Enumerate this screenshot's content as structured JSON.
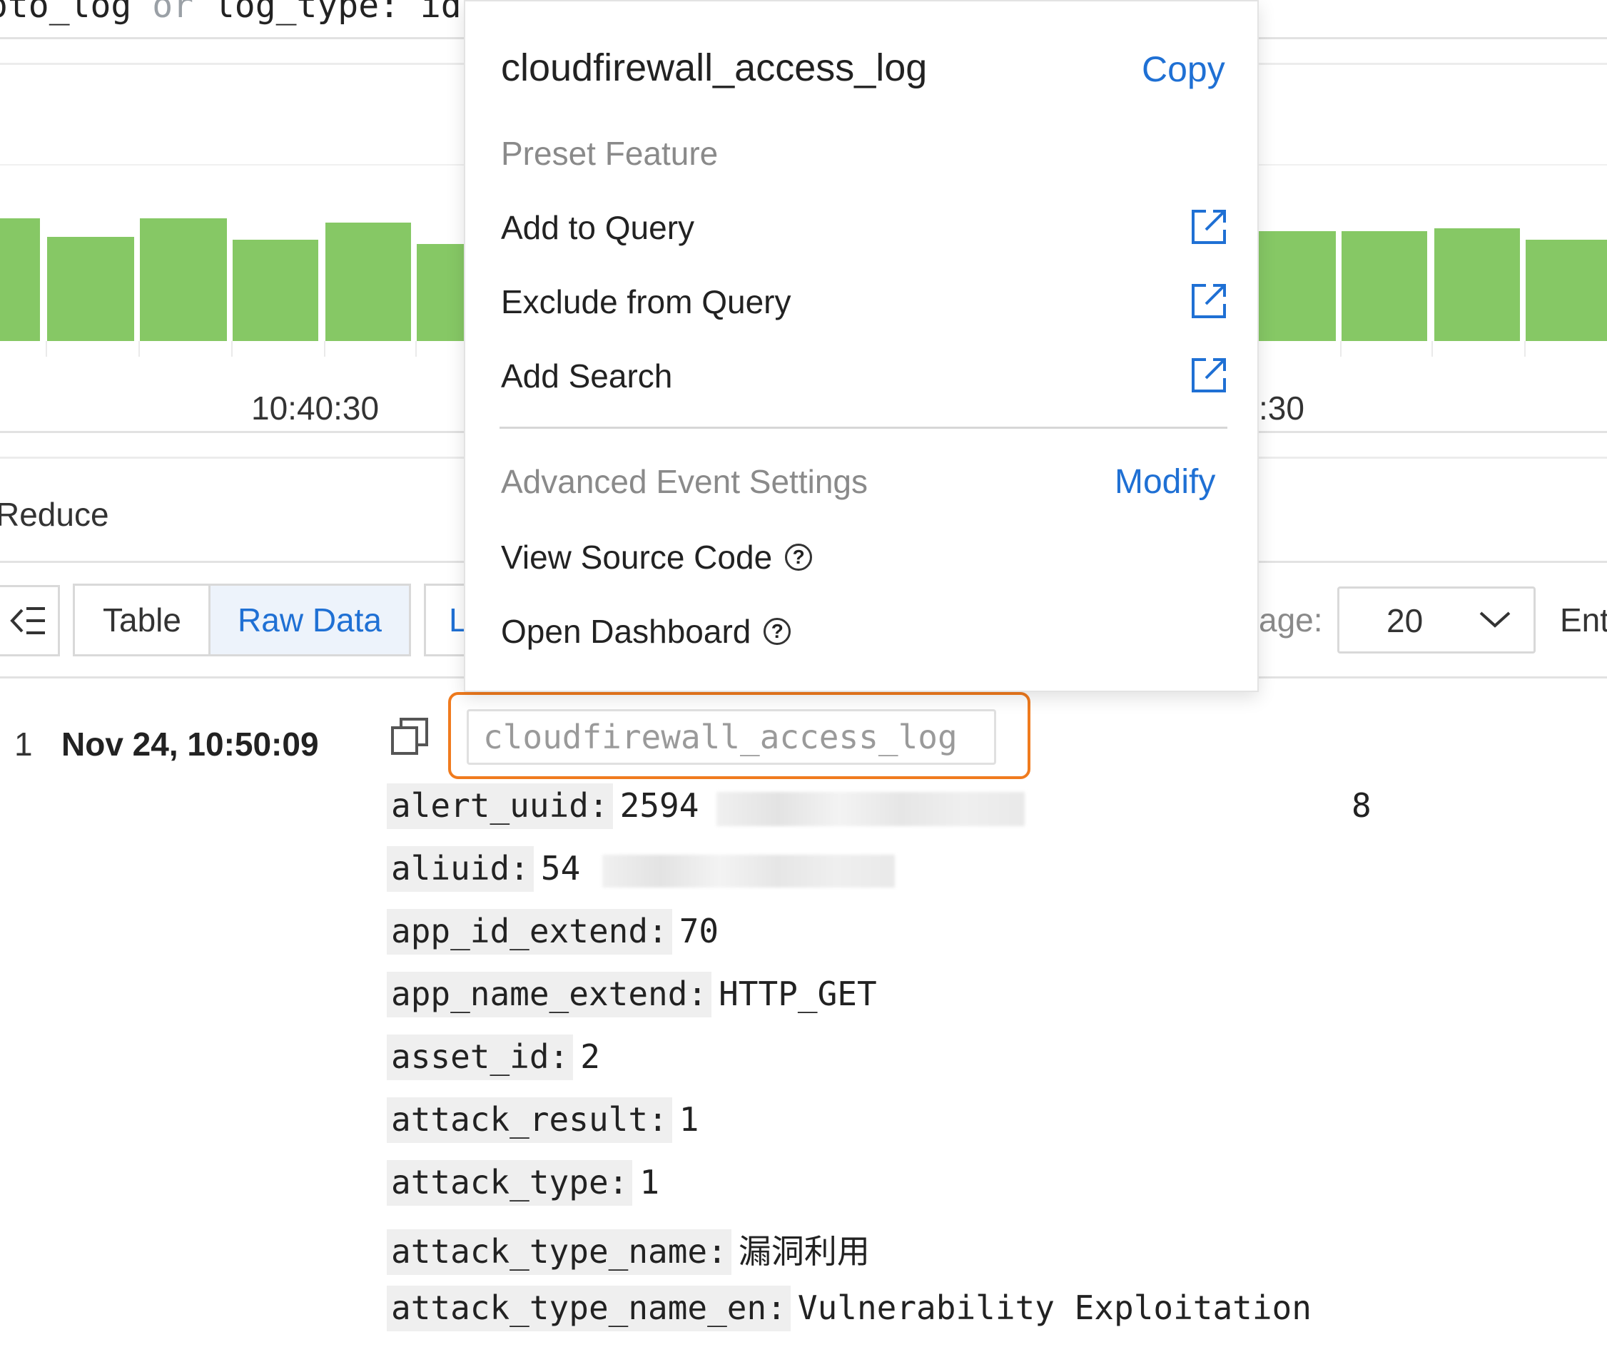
{
  "query_bar": {
    "text_left": "oto_log",
    "text_op": "or",
    "text_right": "log_type: id"
  },
  "histogram": {
    "time_label_left": "10:40:30",
    "time_label_right": ":30",
    "bar_color": "#86c865"
  },
  "reduce_label": "Reduce",
  "toolbar": {
    "collapse_icon": "indent-left-icon",
    "table_label": "Table",
    "raw_data_label": "Raw Data",
    "partial_tab_label": "L",
    "per_page_label": "age:",
    "page_size_value": "20",
    "entries_label": "Ent"
  },
  "popup": {
    "title": "cloudfirewall_access_log",
    "copy_label": "Copy",
    "preset_section": "Preset Feature",
    "add_to_query": "Add to Query",
    "exclude_from_query": "Exclude from Query",
    "add_search": "Add Search",
    "advanced_section": "Advanced Event Settings",
    "modify_label": "Modify",
    "view_source_code": "View Source Code",
    "open_dashboard": "Open Dashboard",
    "link_color": "#1f70d4"
  },
  "log": {
    "index": "1",
    "time": "Nov 24, 10:50:09",
    "topic": "cloudfirewall_access_log",
    "fields": [
      {
        "key": "alert_uuid:",
        "value": "2594",
        "tail": "8"
      },
      {
        "key": "aliuid:",
        "value": "54",
        "tail": ""
      },
      {
        "key": "app_id_extend:",
        "value": "70",
        "tail": ""
      },
      {
        "key": "app_name_extend:",
        "value": "HTTP_GET",
        "tail": ""
      },
      {
        "key": "asset_id:",
        "value": "2",
        "tail": ""
      },
      {
        "key": "attack_result:",
        "value": "1",
        "tail": ""
      },
      {
        "key": "attack_type:",
        "value": "1",
        "tail": ""
      },
      {
        "key": "attack_type_name:",
        "value": "漏洞利用",
        "tail": ""
      },
      {
        "key": "attack_type_name_en:",
        "value": "Vulnerability Exploitation",
        "tail": ""
      }
    ]
  },
  "highlight_color": "#f07b1e"
}
